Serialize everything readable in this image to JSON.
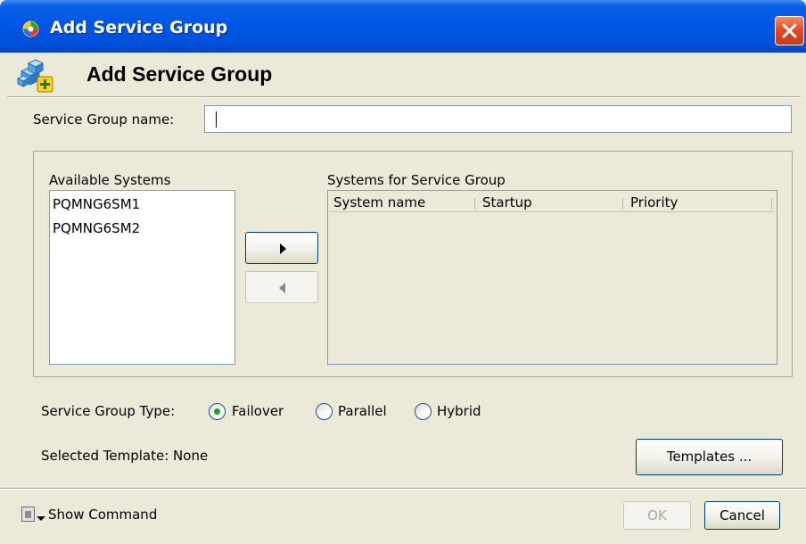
{
  "window": {
    "title": "Add Service Group",
    "titlebar_color": "#0055E5",
    "close_button_color": "#E04A22"
  },
  "header": {
    "title": "Add Service Group",
    "icon": "service-group-add-icon"
  },
  "service_group_name": {
    "label": "Service Group name:",
    "value": ""
  },
  "available_systems": {
    "label": "Available Systems",
    "items": [
      "PQMNG6SM1",
      "PQMNG6SM2"
    ]
  },
  "systems_for_group": {
    "label": "Systems for Service Group",
    "columns": [
      "System name",
      "Startup",
      "Priority"
    ],
    "rows": []
  },
  "transfer": {
    "add_icon": "arrow-right-icon",
    "remove_icon": "arrow-left-icon",
    "remove_enabled": false
  },
  "service_group_type": {
    "label": "Service Group Type:",
    "options": [
      "Failover",
      "Parallel",
      "Hybrid"
    ],
    "selected": "Failover"
  },
  "template": {
    "label": "Selected Template: None",
    "button": "Templates ..."
  },
  "footer": {
    "show_command": "Show Command",
    "ok": "OK",
    "ok_enabled": false,
    "cancel": "Cancel"
  }
}
